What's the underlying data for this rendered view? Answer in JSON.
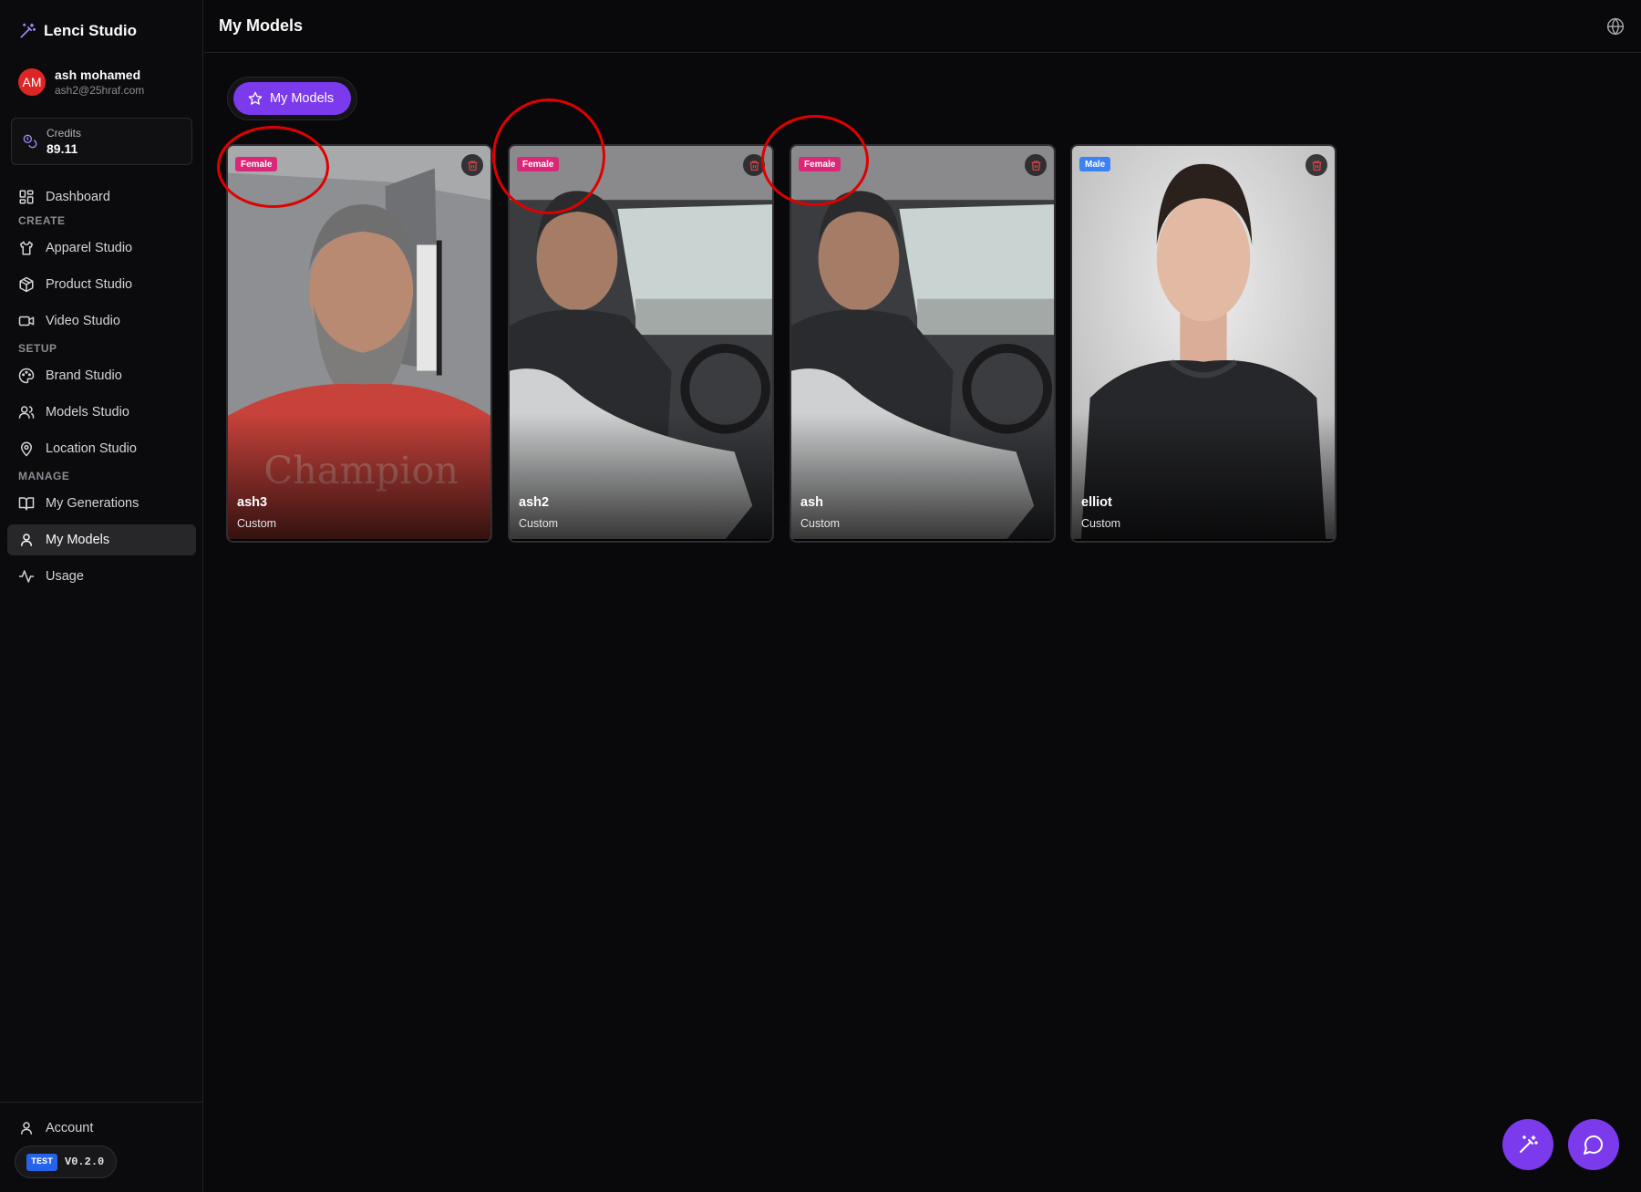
{
  "brand": {
    "name": "Lenci Studio",
    "icon": "magic-wand-icon"
  },
  "user": {
    "initials": "AM",
    "name": "ash mohamed",
    "email": "ash2@25hraf.com"
  },
  "credits": {
    "label": "Credits",
    "value": "89.11"
  },
  "nav": {
    "dashboard": "Dashboard",
    "section_create": "CREATE",
    "apparel": "Apparel Studio",
    "product": "Product Studio",
    "video": "Video Studio",
    "section_setup": "SETUP",
    "brand": "Brand Studio",
    "models": "Models Studio",
    "location": "Location Studio",
    "section_manage": "MANAGE",
    "generations": "My Generations",
    "my_models": "My Models",
    "usage": "Usage",
    "account": "Account",
    "active": "My Models"
  },
  "build": {
    "tag": "TEST",
    "version": "V0.2.0"
  },
  "header": {
    "title": "My Models"
  },
  "tabs": [
    {
      "label": "My Models",
      "active": true
    }
  ],
  "models": [
    {
      "name": "ash3",
      "type": "Custom",
      "gender": "Female"
    },
    {
      "name": "ash2",
      "type": "Custom",
      "gender": "Female"
    },
    {
      "name": "ash",
      "type": "Custom",
      "gender": "Female"
    },
    {
      "name": "elliot",
      "type": "Custom",
      "gender": "Male"
    }
  ],
  "colors": {
    "accent": "#7c3aed",
    "female_badge": "#db2777",
    "male_badge": "#3b82f6",
    "annotation_circle": "#e00000",
    "background": "#09090b"
  }
}
